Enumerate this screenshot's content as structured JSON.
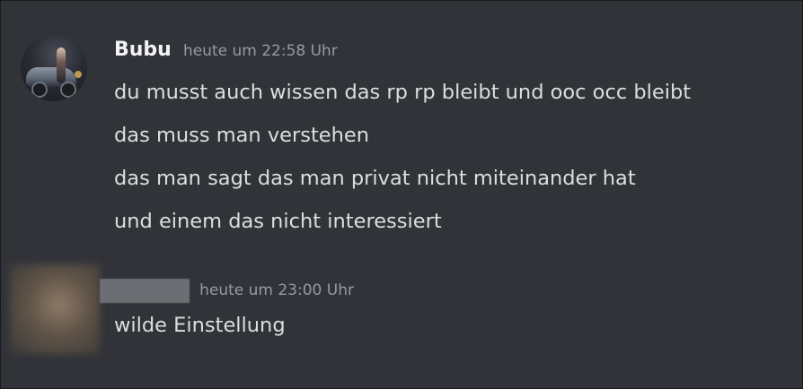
{
  "messages": [
    {
      "author": "Bubu",
      "timestamp": "heute um 22:58 Uhr",
      "lines": [
        "du musst auch wissen das rp rp bleibt und ooc occ bleibt",
        "das muss man verstehen",
        "das man sagt das man privat nicht miteinander hat",
        "und einem das nicht interessiert"
      ]
    },
    {
      "author": "",
      "timestamp": "heute um 23:00 Uhr",
      "lines": [
        "wilde Einstellung"
      ]
    }
  ],
  "colors": {
    "background": "#313338",
    "username": "#f2f3f5",
    "timestamp": "#949ba4",
    "message_text": "#dbdee1"
  }
}
